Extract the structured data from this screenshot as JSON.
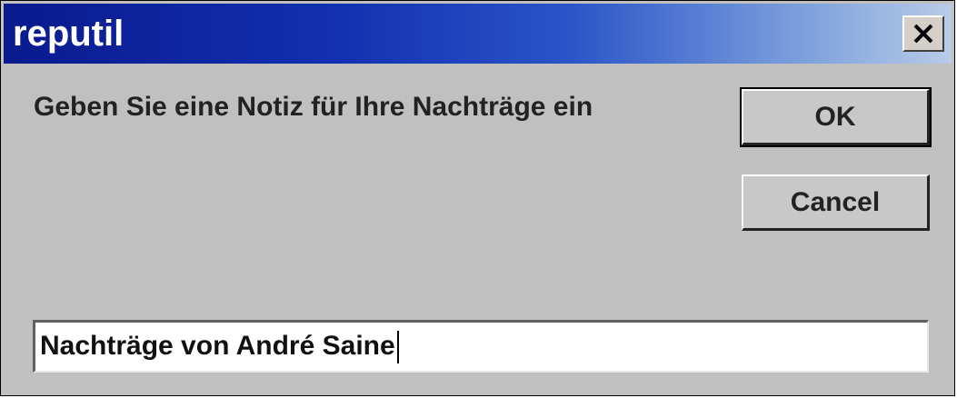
{
  "window": {
    "title": "reputil",
    "close_icon": "close-icon"
  },
  "dialog": {
    "prompt": "Geben Sie eine Notiz für Ihre Nachträge ein",
    "ok_label": "OK",
    "cancel_label": "Cancel",
    "input_value": "Nachträge von André Saine"
  }
}
